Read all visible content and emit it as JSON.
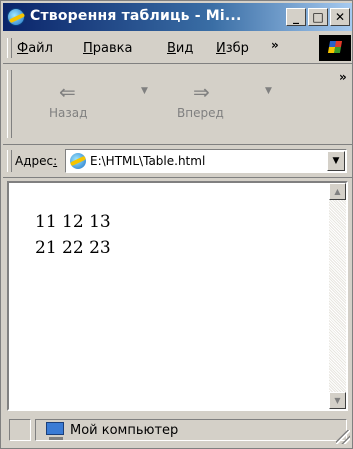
{
  "window": {
    "title": "Створення таблиць - Mi..."
  },
  "titlebar_buttons": {
    "minimize": "_",
    "maximize": "□",
    "close": "✕"
  },
  "menu": {
    "items": [
      {
        "accel": "Ф",
        "rest": "айл"
      },
      {
        "accel": "П",
        "rest": "равка"
      },
      {
        "accel": "В",
        "rest": "ид"
      },
      {
        "accel": "И",
        "rest": "збр"
      }
    ],
    "overflow": "»"
  },
  "toolbar": {
    "back_label": "Назад",
    "forward_label": "Вперед",
    "overflow": "»"
  },
  "address": {
    "label_pre": "Адрес",
    "label_accel": ":",
    "value": "E:\\HTML\\Table.html"
  },
  "document": {
    "rows": [
      "11 12 13",
      "21 22 23"
    ]
  },
  "status": {
    "zone_text": "Мой компьютер"
  },
  "icons": {
    "title": "ie-icon",
    "address": "ie-page-icon",
    "status": "my-computer-icon",
    "brand": "windows-logo-icon"
  }
}
